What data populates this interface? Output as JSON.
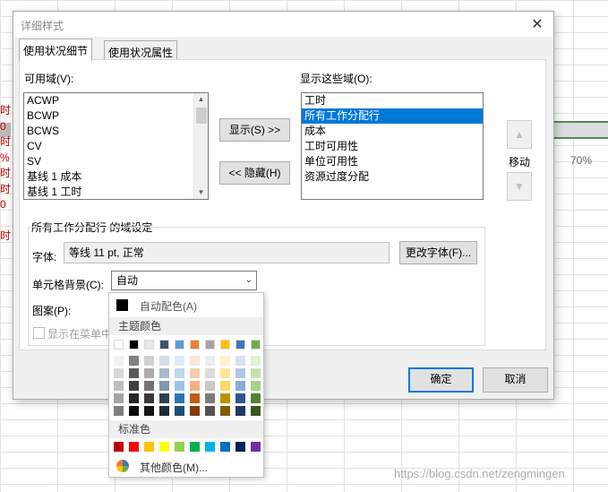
{
  "sheet": {
    "left_cells": [
      "时",
      "0",
      "时",
      "%",
      "时",
      "时",
      "0",
      "",
      "时"
    ],
    "percent_cell": "70%",
    "watermark": "https://blog.csdn.net/zengmingen"
  },
  "dialog": {
    "title": "详细样式",
    "tabs": [
      "使用状况细节",
      "使用状况属性"
    ],
    "available_label": "可用域(V):",
    "available_items": [
      "ACWP",
      "BCWP",
      "BCWS",
      "CV",
      "SV",
      "基线 1 成本",
      "基线 1 工时"
    ],
    "shown_label": "显示这些域(O):",
    "shown_items": [
      "工时",
      "所有工作分配行",
      "成本",
      "工时可用性",
      "单位可用性",
      "资源过度分配"
    ],
    "shown_selected_index": 1,
    "show_button": "显示(S) >>",
    "hide_button": "<< 隐藏(H)",
    "move_label": "移动",
    "group_title": "所有工作分配行 的域设定",
    "font_label": "字体:",
    "font_value": "等线 11 pt, 正常",
    "change_font_button": "更改字体(F)...",
    "cell_bg_label": "单元格背景(C):",
    "cell_bg_value": "自动",
    "pattern_label": "图案(P):",
    "show_in_menu_label": "显示在菜单中",
    "ok_button": "确定",
    "cancel_button": "取消"
  },
  "color_popup": {
    "auto_label": "自动配色(A)",
    "theme_title": "主题颜色",
    "theme_top": [
      "#ffffff",
      "#000000",
      "#e7e6e6",
      "#44546a",
      "#5b9bd5",
      "#ed7d31",
      "#a5a5a5",
      "#ffc000",
      "#4472c4",
      "#70ad47"
    ],
    "theme_shades": [
      [
        "#f2f2f2",
        "#808080",
        "#d0cece",
        "#d6dce4",
        "#deebf6",
        "#fbe5d5",
        "#ededed",
        "#fff2cc",
        "#d9e2f3",
        "#e2efd9"
      ],
      [
        "#d8d8d8",
        "#595959",
        "#aeabab",
        "#adb9ca",
        "#bdd7ee",
        "#f7cbac",
        "#dbdbdb",
        "#fee599",
        "#b4c6e7",
        "#c5e0b3"
      ],
      [
        "#bfbfbf",
        "#3f3f3f",
        "#757070",
        "#8496b0",
        "#9dc3e6",
        "#f4b083",
        "#c9c9c9",
        "#ffd965",
        "#8eaadb",
        "#a8d08d"
      ],
      [
        "#a5a5a5",
        "#262626",
        "#3a3838",
        "#323f4f",
        "#2e75b5",
        "#c55a11",
        "#7b7b7b",
        "#bf9000",
        "#2f5496",
        "#538135"
      ],
      [
        "#7f7f7f",
        "#0c0c0c",
        "#171616",
        "#222a35",
        "#1e4e79",
        "#833c0b",
        "#525252",
        "#7f6000",
        "#1f3864",
        "#375623"
      ]
    ],
    "standard_title": "标准色",
    "standard": [
      "#c00000",
      "#ff0000",
      "#ffc000",
      "#ffff00",
      "#92d050",
      "#00b050",
      "#00b0f0",
      "#0070c0",
      "#002060",
      "#7030a0"
    ],
    "more_label": "其他颜色(M)..."
  }
}
